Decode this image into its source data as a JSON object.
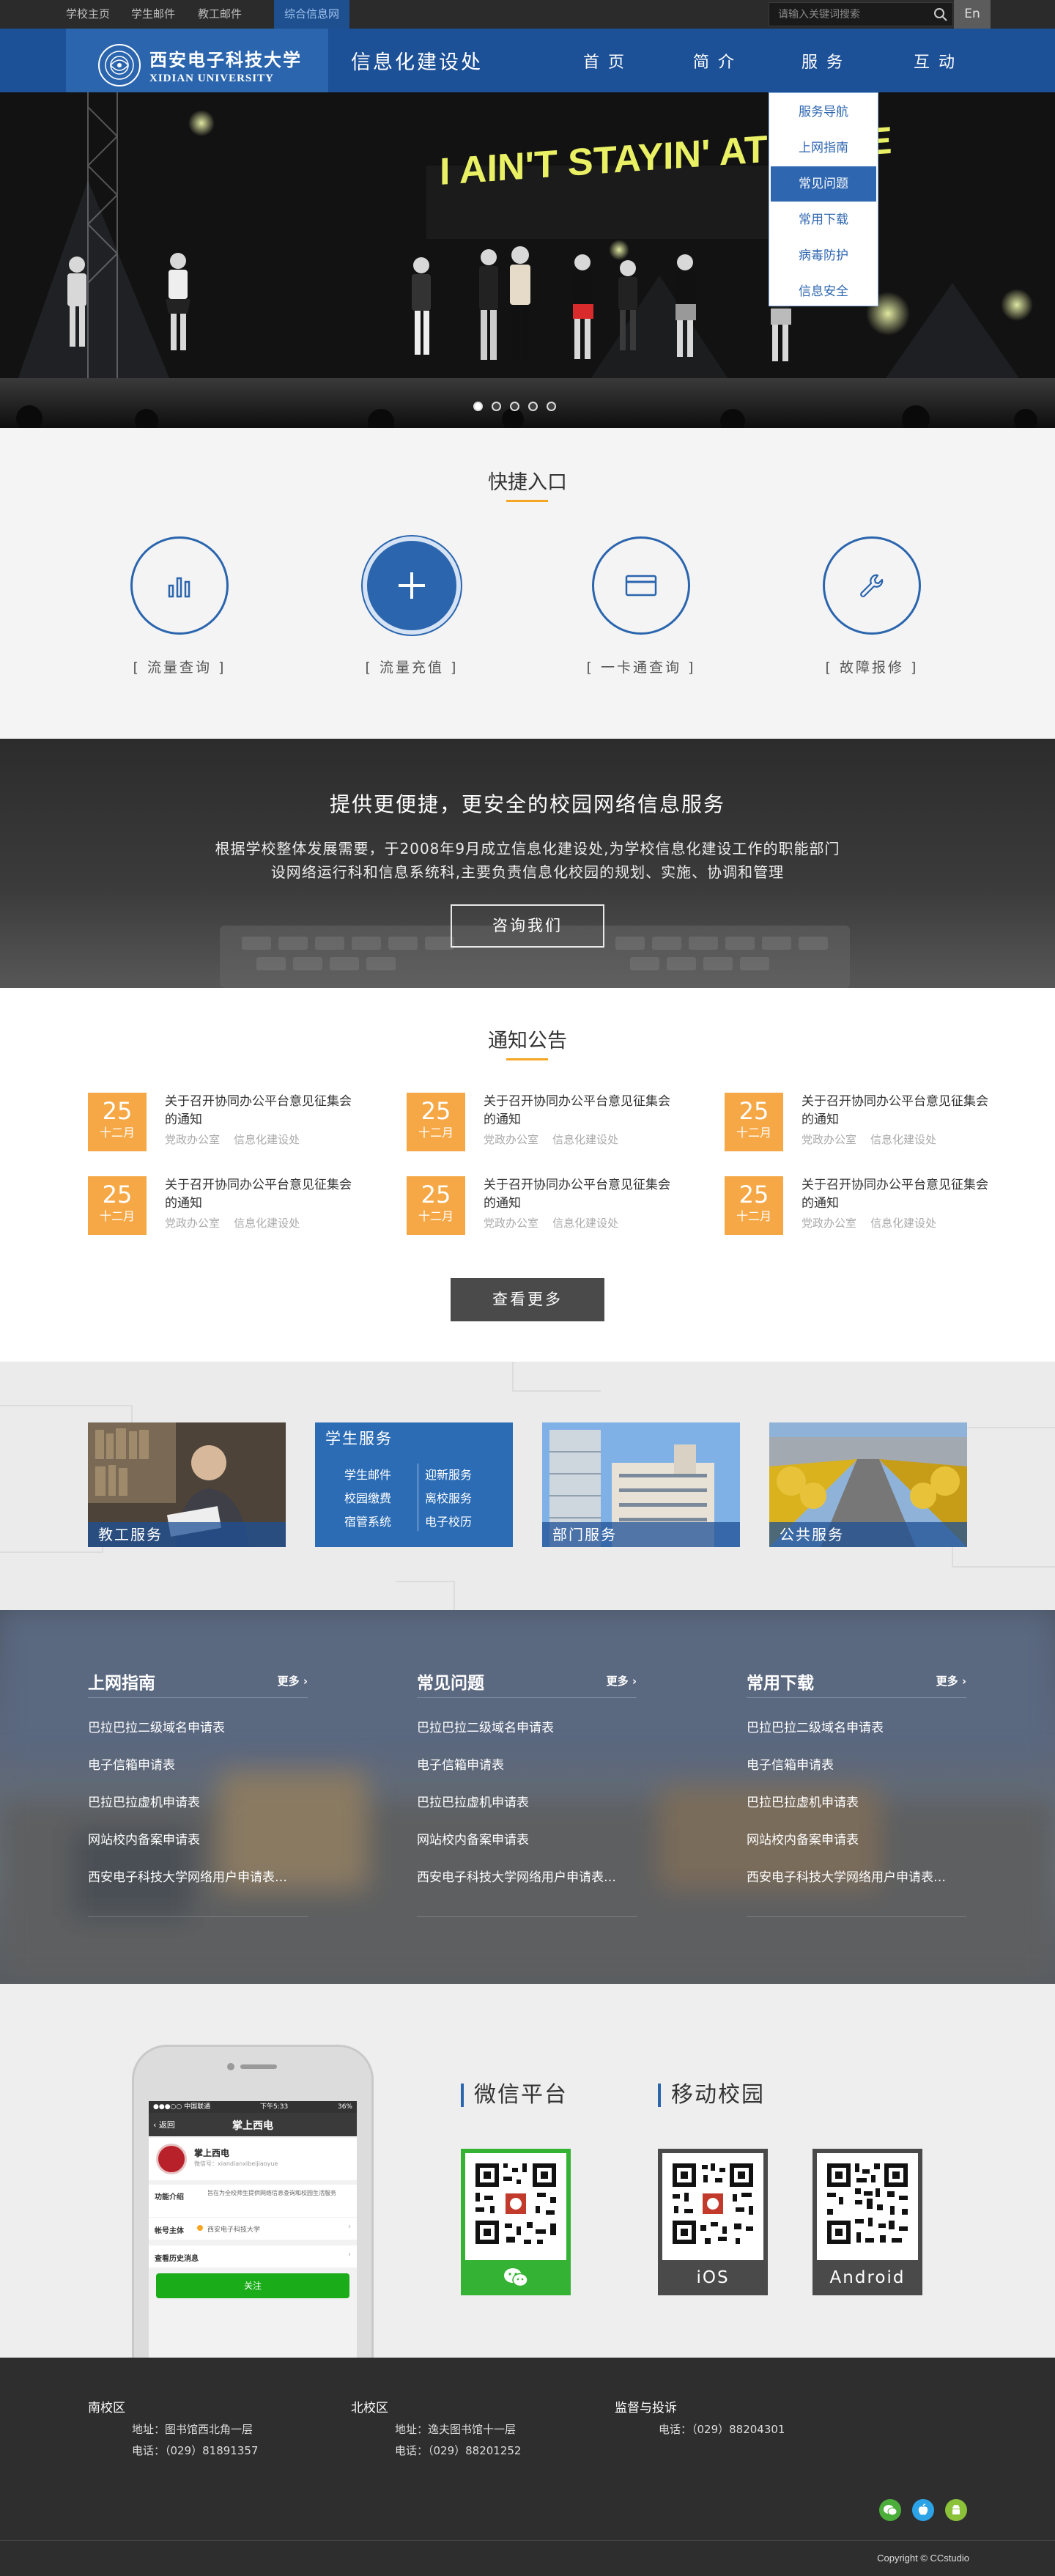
{
  "topbar": {
    "links": [
      "学校主页",
      "学生邮件",
      "教工邮件",
      "综合信息网"
    ],
    "search_placeholder": "请输入关键词搜索",
    "lang": "En"
  },
  "nav": {
    "logo_cn": "西安电子科技大学",
    "logo_en": "XIDIAN UNIVERSITY",
    "site_title": "信息化建设处",
    "items": [
      "首页",
      "简介",
      "服务",
      "互动"
    ],
    "dropdown": [
      "服务导航",
      "上网指南",
      "常见问题",
      "常用下载",
      "病毒防护",
      "信息安全"
    ],
    "dropdown_selected": "常见问题"
  },
  "hero": {
    "sign_text": "I AIN'T STAYIN' AT HOME",
    "slides": 5,
    "active_slide": 1
  },
  "quick": {
    "title": "快捷入口",
    "items": [
      {
        "label": "[ 流量查询 ]",
        "icon": "bar-chart-icon"
      },
      {
        "label": "[ 流量充值 ]",
        "icon": "plus-icon"
      },
      {
        "label": "[ 一卡通查询 ]",
        "icon": "card-icon"
      },
      {
        "label": "[ 故障报修 ]",
        "icon": "wrench-icon"
      }
    ]
  },
  "banner": {
    "title": "提供更便捷，更安全的校园网络信息服务",
    "line1": "根据学校整体发展需要，于2008年9月成立信息化建设处,为学校信息化建设工作的职能部门",
    "line2": "设网络运行科和信息系统科,主要负责信息化校园的规划、实施、协调和管理",
    "button": "咨询我们"
  },
  "notices": {
    "title": "通知公告",
    "items": [
      {
        "day": "25",
        "month": "十二月",
        "title": "关于召开协同办公平台意见征集会的通知",
        "dept": "党政办公室",
        "tag": "信息化建设处"
      },
      {
        "day": "25",
        "month": "十二月",
        "title": "关于召开协同办公平台意见征集会的通知",
        "dept": "党政办公室",
        "tag": "信息化建设处"
      },
      {
        "day": "25",
        "month": "十二月",
        "title": "关于召开协同办公平台意见征集会的通知",
        "dept": "党政办公室",
        "tag": "信息化建设处"
      },
      {
        "day": "25",
        "month": "十二月",
        "title": "关于召开协同办公平台意见征集会的通知",
        "dept": "党政办公室",
        "tag": "信息化建设处"
      },
      {
        "day": "25",
        "month": "十二月",
        "title": "关于召开协同办公平台意见征集会的通知",
        "dept": "党政办公室",
        "tag": "信息化建设处"
      },
      {
        "day": "25",
        "month": "十二月",
        "title": "关于召开协同办公平台意见征集会的通知",
        "dept": "党政办公室",
        "tag": "信息化建设处"
      }
    ],
    "more": "查看更多"
  },
  "services": {
    "teacher": "教工服务",
    "student": {
      "title": "学生服务",
      "links": [
        "学生邮件",
        "迎新服务",
        "校园缴费",
        "离校服务",
        "宿管系统",
        "电子校历"
      ]
    },
    "dept": "部门服务",
    "public": "公共服务"
  },
  "guides": {
    "more": "更多",
    "columns": [
      {
        "title": "上网指南",
        "items": [
          "巴拉巴拉二级域名申请表",
          "电子信箱申请表",
          "巴拉巴拉虚机申请表",
          "网站校内备案申请表",
          "西安电子科技大学网络用户申请表…"
        ]
      },
      {
        "title": "常见问题",
        "items": [
          "巴拉巴拉二级域名申请表",
          "电子信箱申请表",
          "巴拉巴拉虚机申请表",
          "网站校内备案申请表",
          "西安电子科技大学网络用户申请表…"
        ]
      },
      {
        "title": "常用下载",
        "items": [
          "巴拉巴拉二级域名申请表",
          "电子信箱申请表",
          "巴拉巴拉虚机申请表",
          "网站校内备案申请表",
          "西安电子科技大学网络用户申请表…"
        ]
      }
    ]
  },
  "mobile": {
    "phone": {
      "status_left": "●●●○○ 中国联通",
      "status_time": "下午5:33",
      "status_right": "36%",
      "back": "返回",
      "title": "掌上西电",
      "account_name": "掌上西电",
      "account_id": "微信号：xiandianxibeijiaoyue",
      "func_label": "功能介绍",
      "func_text": "旨在为全校师生提供网络信息查询和校园生活服务",
      "owner_label": "帐号主体",
      "owner_value": "西安电子科技大学",
      "history": "查看历史消息",
      "follow": "关注"
    },
    "wechat_title": "微信平台",
    "mobile_title": "移动校园",
    "ios": "iOS",
    "android": "Android"
  },
  "footer": {
    "south": {
      "title": "南校区",
      "addr": "地址：图书馆西北角一层",
      "tel": "电话：（029）81891357"
    },
    "north": {
      "title": "北校区",
      "addr": "地址：逸夫图书馆十一层",
      "tel": "电话：（029）88201252"
    },
    "supervise": {
      "title": "监督与投诉",
      "tel": "电话：（029）88204301"
    },
    "copyright": "Copyright © CCstudio"
  },
  "colors": {
    "primary": "#1c5097",
    "accent": "#f5a845",
    "dark": "#2e2e2e",
    "wechat": "#34b233"
  }
}
